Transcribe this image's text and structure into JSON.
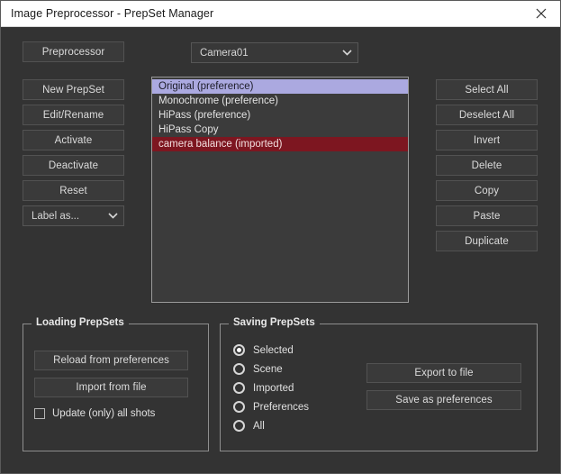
{
  "window": {
    "title": "Image Preprocessor - PrepSet Manager",
    "close_icon": "close-icon"
  },
  "toolbar": {
    "preprocessor_label": "Preprocessor"
  },
  "camera_select": {
    "value": "Camera01",
    "chevron_icon": "chevron-down-icon"
  },
  "left_actions": [
    {
      "label": "New PrepSet",
      "name": "new-prepset-button"
    },
    {
      "label": "Edit/Rename",
      "name": "edit-rename-button"
    },
    {
      "label": "Activate",
      "name": "activate-button"
    },
    {
      "label": "Deactivate",
      "name": "deactivate-button"
    },
    {
      "label": "Reset",
      "name": "reset-button"
    }
  ],
  "label_as_select": {
    "value": "Label as...",
    "chevron_icon": "chevron-down-icon"
  },
  "right_actions": [
    {
      "label": "Select All",
      "name": "select-all-button"
    },
    {
      "label": "Deselect All",
      "name": "deselect-all-button"
    },
    {
      "label": "Invert",
      "name": "invert-button"
    },
    {
      "label": "Delete",
      "name": "delete-button"
    },
    {
      "label": "Copy",
      "name": "copy-button"
    },
    {
      "label": "Paste",
      "name": "paste-button"
    },
    {
      "label": "Duplicate",
      "name": "duplicate-button"
    }
  ],
  "prepset_list": {
    "items": [
      {
        "label": "Original (preference)",
        "state": "selected-preference"
      },
      {
        "label": "Monochrome (preference)",
        "state": "normal"
      },
      {
        "label": "HiPass (preference)",
        "state": "normal"
      },
      {
        "label": "HiPass Copy",
        "state": "normal"
      },
      {
        "label": "camera balance (imported)",
        "state": "selected-imported"
      }
    ]
  },
  "loading_group": {
    "title": "Loading PrepSets",
    "reload_label": "Reload from preferences",
    "import_label": "Import from file",
    "update_checkbox": {
      "label": "Update (only) all shots",
      "checked": false
    }
  },
  "saving_group": {
    "title": "Saving PrepSets",
    "radios": [
      {
        "label": "Selected",
        "checked": true
      },
      {
        "label": "Scene",
        "checked": false
      },
      {
        "label": "Imported",
        "checked": false
      },
      {
        "label": "Preferences",
        "checked": false
      },
      {
        "label": "All",
        "checked": false
      }
    ],
    "export_label": "Export to file",
    "save_prefs_label": "Save as preferences"
  },
  "colors": {
    "window_bg": "#333333",
    "titlebar_bg": "#ffffff",
    "button_bg": "#3a3a3a",
    "selection_preference": "#aba9e0",
    "selection_imported": "#7d1620"
  }
}
